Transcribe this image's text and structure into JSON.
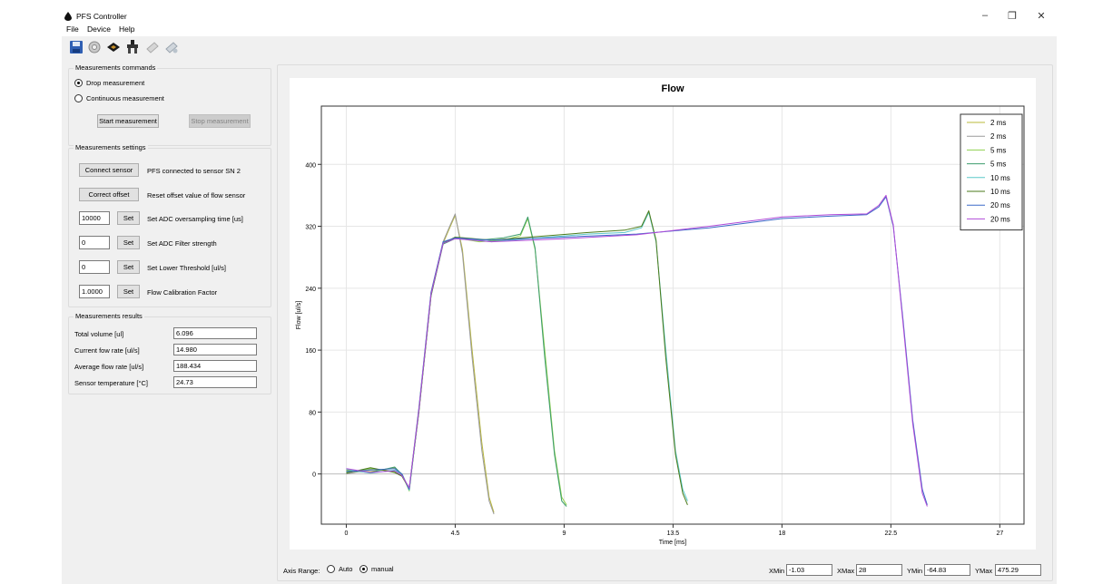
{
  "window": {
    "title": "PFS Controller",
    "minimize_glyph": "–",
    "restore_glyph": "❐",
    "close_glyph": "✕"
  },
  "menu": [
    "File",
    "Device",
    "Help"
  ],
  "toolbar_icons": [
    "save-icon",
    "gear-icon",
    "sensor-icon",
    "pump-icon",
    "disconnect-icon",
    "reconnect-icon"
  ],
  "commands": {
    "title": "Measurements commands",
    "drop_label": "Drop measurement",
    "continuous_label": "Continuous measurement",
    "selected": "drop",
    "start_label": "Start measurement",
    "stop_label": "Stop measurement"
  },
  "settings": {
    "title": "Measurements settings",
    "connect_label": "Connect sensor",
    "connect_status": "PFS connected to sensor SN 2",
    "offset_label": "Correct offset",
    "offset_desc": "Reset offset value of flow sensor",
    "set_label": "Set",
    "rows": [
      {
        "value": "10000",
        "desc": "Set ADC oversampling time [us]"
      },
      {
        "value": "0",
        "desc": "Set ADC Filter strength"
      },
      {
        "value": "0",
        "desc": "Set Lower Threshold [ul/s]"
      },
      {
        "value": "1.0000",
        "desc": "Flow Calibration Factor"
      }
    ]
  },
  "results": {
    "title": "Measurements results",
    "rows": [
      {
        "label": "Total volume [ul]",
        "value": "6.096"
      },
      {
        "label": "Current fow rate [ul/s]",
        "value": "14.980"
      },
      {
        "label": "Average flow rate [ul/s]",
        "value": "188.434"
      },
      {
        "label": "Sensor temperature [°C]",
        "value": "24.73"
      }
    ]
  },
  "axis_range": {
    "label": "Axis Range:",
    "auto_label": "Auto",
    "manual_label": "manual",
    "selected": "manual",
    "xmin_label": "XMin",
    "xmin": "-1.03",
    "xmax_label": "XMax",
    "xmax": "28",
    "ymin_label": "YMin",
    "ymin": "-64.83",
    "ymax_label": "YMax",
    "ymax": "475.29"
  },
  "chart_data": {
    "type": "line",
    "title": "Flow",
    "xlabel": "Time [ms]",
    "ylabel": "Flow [ul/s]",
    "xlim": [
      -1.03,
      28
    ],
    "ylim": [
      -64.83,
      475.29
    ],
    "xticks": [
      0,
      4.5,
      9,
      13.5,
      18,
      22.5,
      27
    ],
    "xtick_labels": [
      "0",
      "4.5",
      "9",
      "13.5",
      "18",
      "22.5",
      "27"
    ],
    "yticks": [
      0,
      80,
      160,
      240,
      320,
      400
    ],
    "ytick_labels": [
      "0",
      "80",
      "160",
      "240",
      "320",
      "400"
    ],
    "grid": true,
    "legend_position": "top-right",
    "series": [
      {
        "name": "2 ms",
        "color": "#b8b83a",
        "x": [
          0,
          1,
          2,
          2.3,
          2.6,
          3.0,
          3.5,
          4.0,
          4.3,
          4.5,
          4.8,
          5.2,
          5.6,
          5.9,
          6.1
        ],
        "y": [
          5,
          3,
          8,
          0,
          -20,
          80,
          230,
          298,
          320,
          334,
          290,
          160,
          40,
          -30,
          -50
        ]
      },
      {
        "name": "2 ms",
        "color": "#9a9a9a",
        "x": [
          0,
          1,
          2,
          2.3,
          2.6,
          3.0,
          3.5,
          4.0,
          4.3,
          4.5,
          4.8,
          5.2,
          5.6,
          5.9,
          6.1
        ],
        "y": [
          0,
          6,
          4,
          -2,
          -18,
          85,
          235,
          300,
          322,
          336,
          285,
          150,
          30,
          -35,
          -52
        ]
      },
      {
        "name": "5 ms",
        "color": "#8fd14f",
        "x": [
          0,
          1,
          2,
          2.3,
          2.6,
          3.0,
          3.5,
          4.0,
          4.5,
          5.5,
          6.5,
          7.2,
          7.5,
          7.8,
          8.2,
          8.6,
          8.9,
          9.1
        ],
        "y": [
          2,
          7,
          3,
          0,
          -22,
          82,
          232,
          298,
          305,
          300,
          302,
          308,
          330,
          290,
          160,
          30,
          -30,
          -40
        ]
      },
      {
        "name": "5 ms",
        "color": "#3c9c6c",
        "x": [
          0,
          1,
          2,
          2.3,
          2.6,
          3.0,
          3.5,
          4.0,
          4.5,
          5.5,
          6.5,
          7.2,
          7.5,
          7.8,
          8.2,
          8.6,
          8.9,
          9.1
        ],
        "y": [
          4,
          2,
          9,
          -1,
          -20,
          80,
          230,
          297,
          304,
          302,
          305,
          310,
          332,
          292,
          150,
          25,
          -35,
          -42
        ]
      },
      {
        "name": "10 ms",
        "color": "#5ac8c8",
        "x": [
          0,
          1,
          2,
          2.3,
          2.6,
          3.0,
          3.5,
          4.0,
          4.5,
          6,
          8,
          10,
          11.5,
          12.2,
          12.5,
          12.8,
          13.2,
          13.6,
          13.9,
          14.1
        ],
        "y": [
          6,
          1,
          5,
          0,
          -21,
          83,
          233,
          299,
          305,
          300,
          305,
          310,
          312,
          318,
          338,
          300,
          160,
          30,
          -20,
          -35
        ]
      },
      {
        "name": "10 ms",
        "color": "#4a7a1a",
        "x": [
          0,
          1,
          2,
          2.3,
          2.6,
          3.0,
          3.5,
          4.0,
          4.5,
          6,
          8,
          10,
          11.5,
          12.2,
          12.5,
          12.8,
          13.2,
          13.6,
          13.9,
          14.1
        ],
        "y": [
          1,
          8,
          2,
          -3,
          -19,
          81,
          231,
          298,
          306,
          302,
          307,
          312,
          315,
          320,
          340,
          302,
          150,
          25,
          -25,
          -40
        ]
      },
      {
        "name": "20 ms",
        "color": "#3c6ac8",
        "x": [
          0,
          1,
          2,
          2.3,
          2.6,
          3.0,
          3.5,
          4.0,
          4.5,
          6,
          9,
          12,
          15,
          18,
          20,
          21.5,
          22,
          22.3,
          22.6,
          23,
          23.4,
          23.8,
          24.0
        ],
        "y": [
          3,
          5,
          7,
          0,
          -20,
          84,
          234,
          300,
          305,
          302,
          306,
          310,
          318,
          330,
          333,
          335,
          345,
          358,
          320,
          200,
          70,
          -20,
          -40
        ]
      },
      {
        "name": "20 ms",
        "color": "#b04ad8",
        "x": [
          0,
          1,
          2,
          2.3,
          2.6,
          3.0,
          3.5,
          4.0,
          4.5,
          6,
          9,
          12,
          15,
          18,
          20,
          21.5,
          22,
          22.3,
          22.6,
          23,
          23.4,
          23.8,
          24.0
        ],
        "y": [
          7,
          2,
          4,
          -2,
          -18,
          82,
          232,
          298,
          304,
          300,
          304,
          309,
          320,
          332,
          335,
          336,
          347,
          360,
          322,
          195,
          65,
          -25,
          -42
        ]
      }
    ]
  }
}
